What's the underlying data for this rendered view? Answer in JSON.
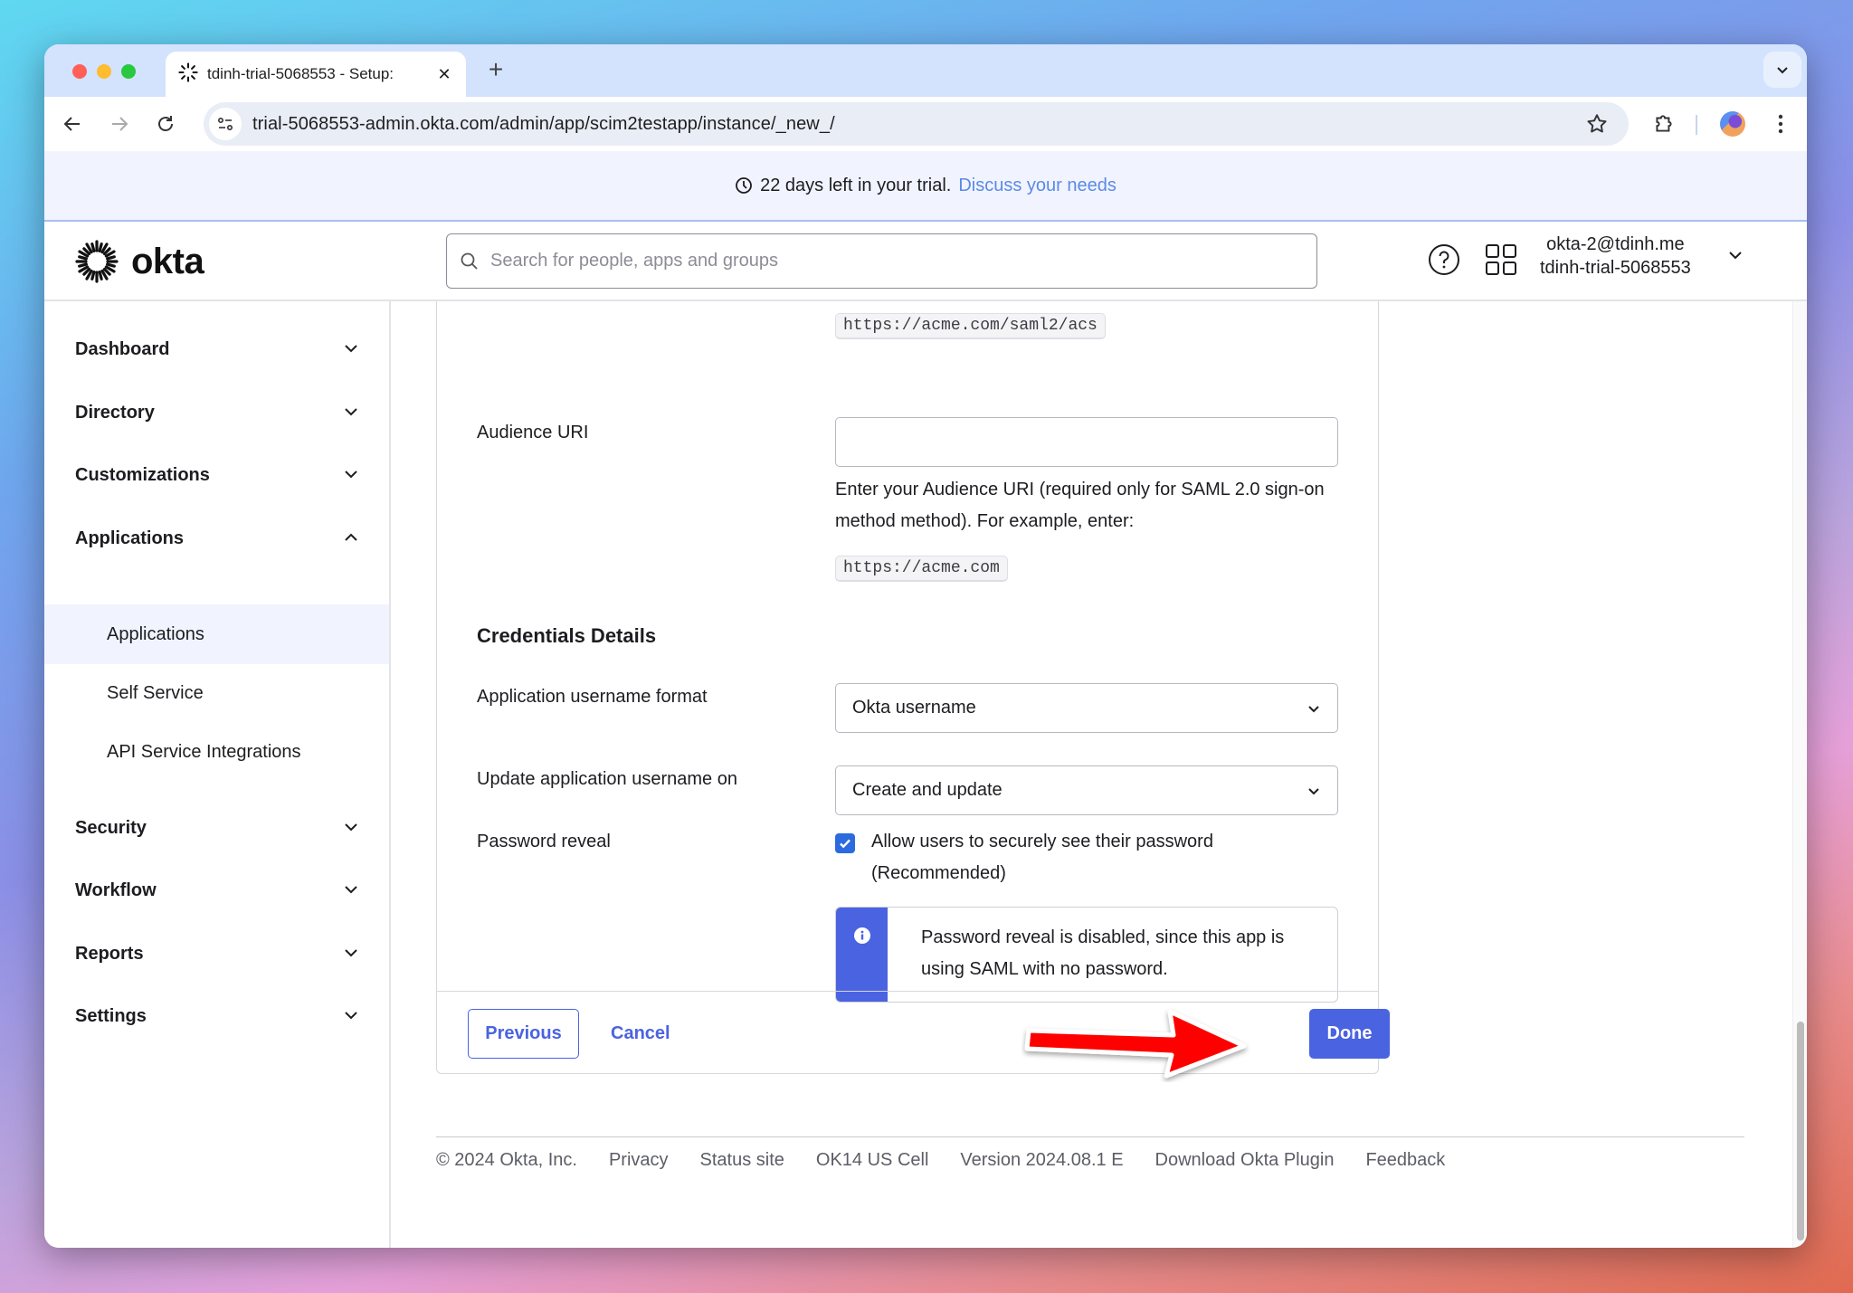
{
  "browser": {
    "tab_title": "tdinh-trial-5068553 - Setup:",
    "url": "trial-5068553-admin.okta.com/admin/app/scim2testapp/instance/_new_/",
    "icons": {
      "back": "arrow-left-icon",
      "forward": "arrow-right-icon",
      "reload": "reload-icon",
      "site_info": "tune-icon",
      "bookmark": "star-icon",
      "extensions": "puzzle-icon",
      "menu": "kebab-menu-icon",
      "tab_search": "chevron-down-icon",
      "new_tab": "plus-icon",
      "close_tab": "close-icon"
    }
  },
  "trial_banner": {
    "message": "22 days left in your trial.",
    "link": "Discuss your needs"
  },
  "header": {
    "logo_text": "okta",
    "search_placeholder": "Search for people, apps and groups",
    "search_value": "",
    "user_email": "okta-2@tdinh.me",
    "org_name": "tdinh-trial-5068553"
  },
  "sidebar": {
    "groups": [
      {
        "label": "Dashboard",
        "expanded": false
      },
      {
        "label": "Directory",
        "expanded": false
      },
      {
        "label": "Customizations",
        "expanded": false
      },
      {
        "label": "Applications",
        "expanded": true
      },
      {
        "label": "Security",
        "expanded": false
      },
      {
        "label": "Workflow",
        "expanded": false
      },
      {
        "label": "Reports",
        "expanded": false
      },
      {
        "label": "Settings",
        "expanded": false
      }
    ],
    "applications_sub": [
      {
        "label": "Applications",
        "active": true
      },
      {
        "label": "Self Service",
        "active": false
      },
      {
        "label": "API Service Integrations",
        "active": false
      }
    ]
  },
  "form": {
    "acs_example": "https://acme.com/saml2/acs",
    "audience_uri": {
      "label": "Audience URI",
      "value": "",
      "help": "Enter your Audience URI (required only for SAML 2.0 sign-on method method). For example, enter:",
      "example": "https://acme.com"
    },
    "credentials": {
      "title": "Credentials Details",
      "username_format": {
        "label": "Application username format",
        "value": "Okta username"
      },
      "update_on": {
        "label": "Update application username on",
        "value": "Create and update"
      },
      "password_reveal": {
        "label": "Password reveal",
        "checked": true,
        "checkbox_label": "Allow users to securely see their password (Recommended)"
      },
      "callout": "Password reveal is disabled, since this app is using SAML with no password."
    },
    "buttons": {
      "previous": "Previous",
      "cancel": "Cancel",
      "done": "Done"
    }
  },
  "footer": {
    "links": [
      "© 2024 Okta, Inc.",
      "Privacy",
      "Status site",
      "OK14 US Cell",
      "Version 2024.08.1 E",
      "Download Okta Plugin",
      "Feedback"
    ]
  },
  "colors": {
    "accent": "#4a63e0",
    "checkbox": "#2c6ae0",
    "annotation_arrow": "#ff0000",
    "trial_link": "#5a8ae6"
  }
}
